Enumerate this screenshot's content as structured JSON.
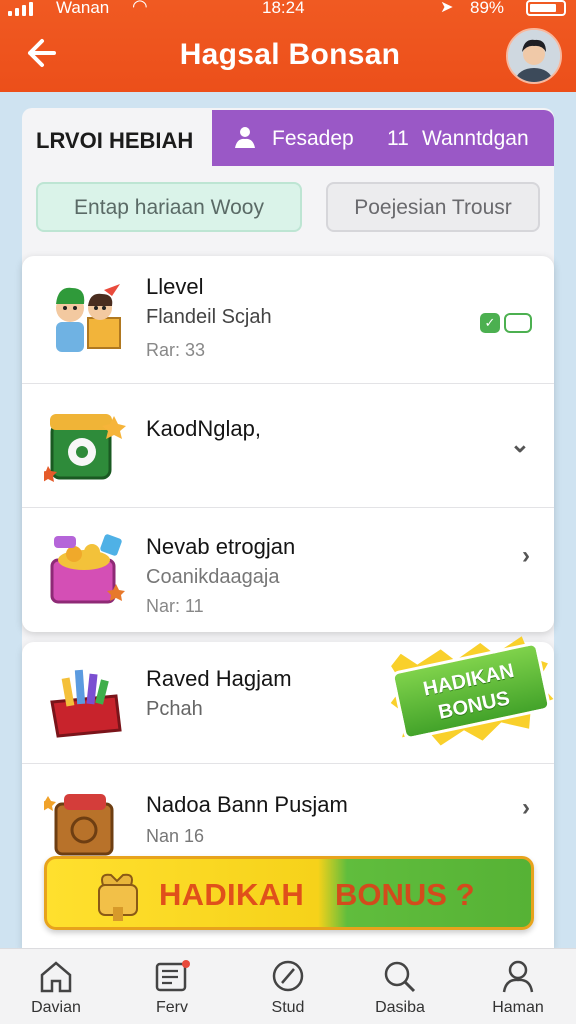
{
  "status_bar": {
    "carrier": "Wanan",
    "time": "18:24",
    "battery": "89%"
  },
  "header": {
    "title": "Hagsal Bonsan"
  },
  "tabs": {
    "left_label": "LRVOI HEBIAH",
    "right_part1": "Fesadep",
    "right_count": "11",
    "right_part2": "Wanntdgan"
  },
  "filters": {
    "chip_a": "Entap hariaan  Wooy",
    "chip_b": "Poejesian  Trousr"
  },
  "list": [
    {
      "line1": "Llevel",
      "line2": "Flandeil Scjah",
      "line3": "Rar: 33",
      "trailing": "toggle"
    },
    {
      "line1": "KaodNglap,",
      "trailing": "chevron"
    },
    {
      "line1": "Nevab etrogjan",
      "line2": "Coanikdaagaja",
      "line3": "Nar: 11",
      "trailing": "chevron"
    },
    {
      "line1": "Raved Hagjam",
      "line2": "Pchah",
      "trailing": "badge"
    },
    {
      "line1": "Nadoa Bann Pusjam",
      "line3": "Nan 16",
      "trailing": "chevron"
    }
  ],
  "badge": {
    "line1": "HADIKAN",
    "line2": "BONUS"
  },
  "promo_banner": {
    "text_a": "HADIKAH",
    "text_b": "BONUS ?"
  },
  "bottom_nav": [
    {
      "label": "Davian",
      "icon": "home-icon"
    },
    {
      "label": "Ferv",
      "icon": "news-icon"
    },
    {
      "label": "Stud",
      "icon": "compass-icon"
    },
    {
      "label": "Dasiba",
      "icon": "search-icon"
    },
    {
      "label": "Haman",
      "icon": "profile-icon"
    }
  ],
  "colors": {
    "header": "#ec4f1a",
    "tab_active": "#9a58c6",
    "accent_green": "#4cb050"
  }
}
